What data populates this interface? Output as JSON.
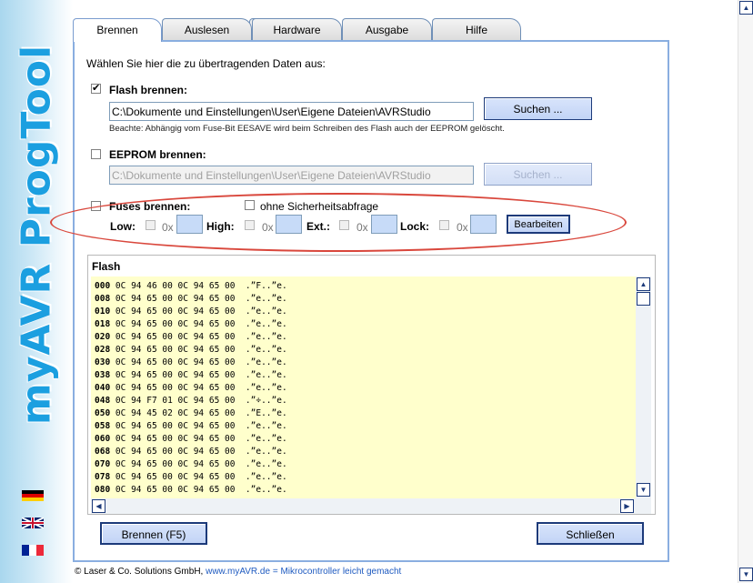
{
  "sidebar": {
    "logo_text": "myAVR ProgTool",
    "flags": [
      "german-flag",
      "british-flag",
      "french-flag"
    ]
  },
  "tabs": [
    {
      "label": "Brennen",
      "active": true
    },
    {
      "label": "Auslesen",
      "active": false
    },
    {
      "label": "Hardware",
      "active": false
    },
    {
      "label": "Ausgabe",
      "active": false
    },
    {
      "label": "Hilfe",
      "active": false
    }
  ],
  "main": {
    "intro": "Wählen Sie hier die zu übertragenden Daten aus:",
    "flash": {
      "label": "Flash brennen:",
      "checked": true,
      "path": "C:\\Dokumente und Einstellungen\\User\\Eigene Dateien\\AVRStudio",
      "search_label": "Suchen ...",
      "note": "Beachte: Abhängig vom Fuse-Bit EESAVE wird beim Schreiben des Flash auch der EEPROM gelöscht."
    },
    "eeprom": {
      "label": "EEPROM brennen:",
      "checked": false,
      "path": "C:\\Dokumente und Einstellungen\\User\\Eigene Dateien\\AVRStudio",
      "search_label": "Suchen ..."
    },
    "fuses": {
      "label": "Fuses brennen:",
      "no_confirm_label": "ohne Sicherheitsabfrage",
      "low_label": "Low:",
      "high_label": "High:",
      "ext_label": "Ext.:",
      "lock_label": "Lock:",
      "hex_prefix": "0x",
      "edit_label": "Bearbeiten"
    },
    "flash_view": {
      "title": "Flash",
      "rows": [
        {
          "addr": "000",
          "bytes": "0C 94 46 00 0C 94 65 00",
          "ascii": ".”F..”e."
        },
        {
          "addr": "008",
          "bytes": "0C 94 65 00 0C 94 65 00",
          "ascii": ".”e..”e."
        },
        {
          "addr": "010",
          "bytes": "0C 94 65 00 0C 94 65 00",
          "ascii": ".”e..”e."
        },
        {
          "addr": "018",
          "bytes": "0C 94 65 00 0C 94 65 00",
          "ascii": ".”e..”e."
        },
        {
          "addr": "020",
          "bytes": "0C 94 65 00 0C 94 65 00",
          "ascii": ".”e..”e."
        },
        {
          "addr": "028",
          "bytes": "0C 94 65 00 0C 94 65 00",
          "ascii": ".”e..”e."
        },
        {
          "addr": "030",
          "bytes": "0C 94 65 00 0C 94 65 00",
          "ascii": ".”e..”e."
        },
        {
          "addr": "038",
          "bytes": "0C 94 65 00 0C 94 65 00",
          "ascii": ".”e..”e."
        },
        {
          "addr": "040",
          "bytes": "0C 94 65 00 0C 94 65 00",
          "ascii": ".”e..”e."
        },
        {
          "addr": "048",
          "bytes": "0C 94 F7 01 0C 94 65 00",
          "ascii": ".”÷..”e."
        },
        {
          "addr": "050",
          "bytes": "0C 94 45 02 0C 94 65 00",
          "ascii": ".”E..”e."
        },
        {
          "addr": "058",
          "bytes": "0C 94 65 00 0C 94 65 00",
          "ascii": ".”e..”e."
        },
        {
          "addr": "060",
          "bytes": "0C 94 65 00 0C 94 65 00",
          "ascii": ".”e..”e."
        },
        {
          "addr": "068",
          "bytes": "0C 94 65 00 0C 94 65 00",
          "ascii": ".”e..”e."
        },
        {
          "addr": "070",
          "bytes": "0C 94 65 00 0C 94 65 00",
          "ascii": ".”e..”e."
        },
        {
          "addr": "078",
          "bytes": "0C 94 65 00 0C 94 65 00",
          "ascii": ".”e..”e."
        },
        {
          "addr": "080",
          "bytes": "0C 94 65 00 0C 94 65 00",
          "ascii": ".”e..”e."
        }
      ]
    },
    "burn_button": "Brennen (F5)",
    "close_button": "Schließen"
  },
  "footer": {
    "copyright": "© Laser & Co. Solutions GmbH,",
    "link": "www.myAVR.de",
    "separator": "=",
    "tagline": "Mikrocontroller leicht gemacht"
  },
  "colors": {
    "accent": "#8aaee0",
    "logo": "#1b9fe0",
    "highlight_ellipse": "#d9473c",
    "hex_background": "#ffffcc"
  }
}
